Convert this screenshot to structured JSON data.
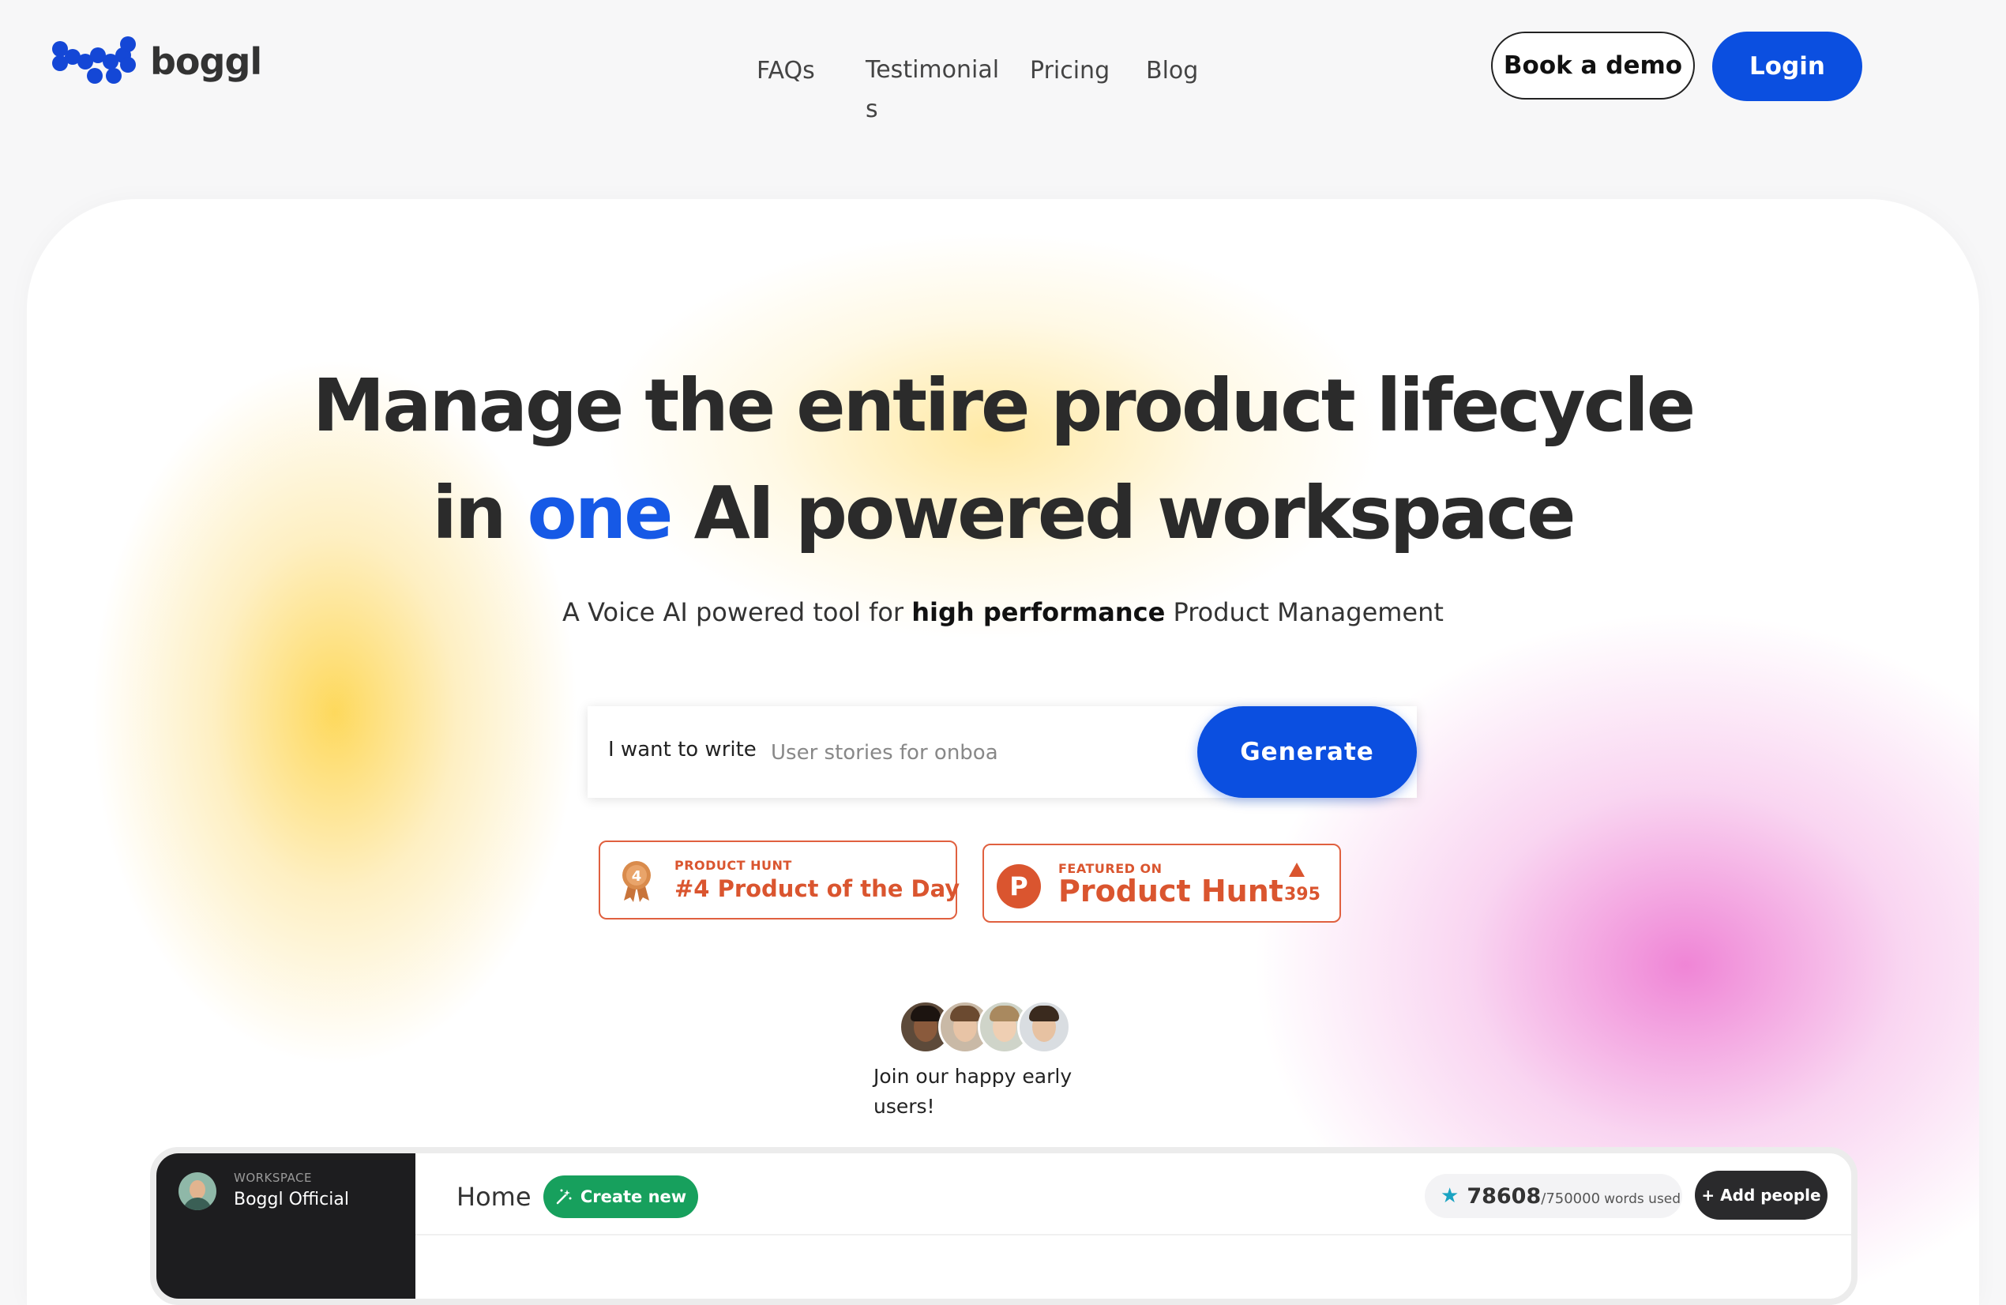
{
  "brand": {
    "name": "boggl",
    "color": "#1447d6"
  },
  "nav": {
    "faqs": "FAQs",
    "testimonials": "Testimonials",
    "pricing": "Pricing",
    "blog": "Blog"
  },
  "header_buttons": {
    "book_demo": "Book a demo",
    "login": "Login"
  },
  "hero": {
    "headline_line1": "Manage the entire product lifecycle",
    "headline_line2_pre": "in ",
    "headline_line2_accent": "one",
    "headline_line2_post": " AI powered workspace",
    "accent_color": "#1659e6",
    "subhead_pre": "A Voice AI powered tool for ",
    "subhead_bold": "high performance",
    "subhead_post": " Product Management"
  },
  "generator": {
    "label": "I want to write",
    "placeholder": "User stories for onboarding onto a SAAS app",
    "button": "Generate"
  },
  "badges": {
    "product_of_day": {
      "kicker": "PRODUCT HUNT",
      "title": "#4 Product of the Day",
      "rank": "4",
      "icon": "medal-icon"
    },
    "featured": {
      "kicker": "FEATURED ON",
      "title": "Product Hunt",
      "letter": "P",
      "upvotes": "395",
      "icon": "upvote-icon"
    },
    "color": "#da552f"
  },
  "early_users": {
    "text": "Join our happy early users!",
    "avatar_count": 4
  },
  "preview": {
    "workspace_label": "WORKSPACE",
    "workspace_name": "Boggl Official",
    "home": "Home",
    "create_new": "Create new",
    "words_used": "78608",
    "words_total": "/750000",
    "words_unit": "words used",
    "add_people": "+ Add people"
  }
}
